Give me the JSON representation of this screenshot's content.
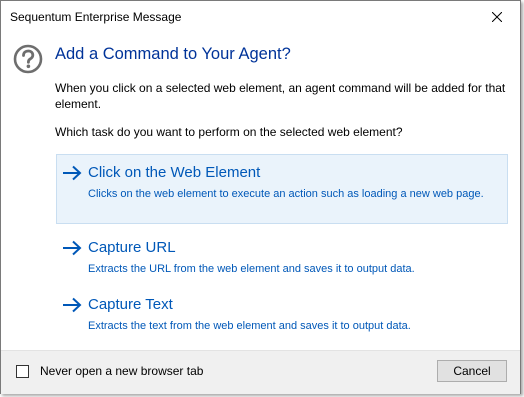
{
  "window": {
    "title": "Sequentum Enterprise Message",
    "close_icon": "close-icon"
  },
  "dialog": {
    "icon": "help-icon",
    "heading": "Add a Command to Your Agent?",
    "description": "When you click on a selected web element, an agent command will be added for that element.",
    "question": "Which task do you want to perform on the selected web element?",
    "accent_color": "#003399",
    "link_color": "#0058b8",
    "options": [
      {
        "title": "Click on the Web Element",
        "subtitle": "Clicks on the web element to execute an action such as loading a new web page.",
        "icon": "arrow-right-icon",
        "hovered": true
      },
      {
        "title": "Capture URL",
        "subtitle": "Extracts the URL from the web element and saves it to output data.",
        "icon": "arrow-right-icon",
        "hovered": false
      },
      {
        "title": "Capture Text",
        "subtitle": "Extracts the text from the web element and saves it to output data.",
        "icon": "arrow-right-icon",
        "hovered": false
      }
    ]
  },
  "footer": {
    "checkbox_label": "Never open a new browser tab",
    "checkbox_checked": false,
    "cancel_label": "Cancel"
  }
}
